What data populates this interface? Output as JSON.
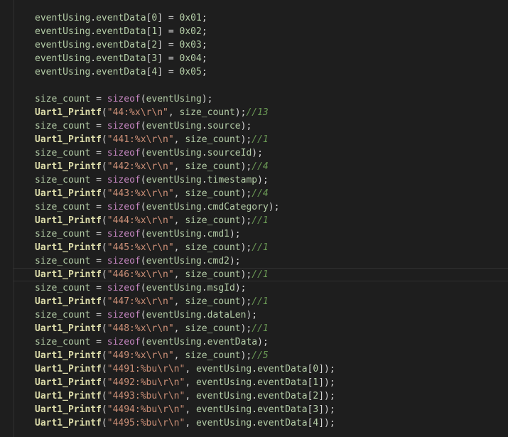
{
  "editor": {
    "colors": {
      "background": "#1e1e1e",
      "variable": "#9cdcfe",
      "identifier": "#b5cea8",
      "function": "#dcdcaa",
      "keyword": "#c586c0",
      "number": "#b5cea8",
      "string": "#ce9178",
      "comment": "#6a9955",
      "punctuation": "#d4d4d4",
      "bracket": "#da70d6"
    },
    "current_line_index": 19,
    "lines": [
      [
        {
          "t": "eventUsing",
          "c": "#b5cea8"
        },
        {
          "t": ".",
          "c": "#d4d4d4"
        },
        {
          "t": "eventData",
          "c": "#b5cea8"
        },
        {
          "t": "[",
          "c": "#d4d4d4"
        },
        {
          "t": "0",
          "c": "#b5cea8"
        },
        {
          "t": "]",
          "c": "#d4d4d4"
        },
        {
          "t": " = ",
          "c": "#d4d4d4"
        },
        {
          "t": "0x01",
          "c": "#b5cea8"
        },
        {
          "t": ";",
          "c": "#d4d4d4"
        }
      ],
      [
        {
          "t": "eventUsing",
          "c": "#b5cea8"
        },
        {
          "t": ".",
          "c": "#d4d4d4"
        },
        {
          "t": "eventData",
          "c": "#b5cea8"
        },
        {
          "t": "[",
          "c": "#d4d4d4"
        },
        {
          "t": "1",
          "c": "#b5cea8"
        },
        {
          "t": "]",
          "c": "#d4d4d4"
        },
        {
          "t": " = ",
          "c": "#d4d4d4"
        },
        {
          "t": "0x02",
          "c": "#b5cea8"
        },
        {
          "t": ";",
          "c": "#d4d4d4"
        }
      ],
      [
        {
          "t": "eventUsing",
          "c": "#b5cea8"
        },
        {
          "t": ".",
          "c": "#d4d4d4"
        },
        {
          "t": "eventData",
          "c": "#b5cea8"
        },
        {
          "t": "[",
          "c": "#d4d4d4"
        },
        {
          "t": "2",
          "c": "#b5cea8"
        },
        {
          "t": "]",
          "c": "#d4d4d4"
        },
        {
          "t": " = ",
          "c": "#d4d4d4"
        },
        {
          "t": "0x03",
          "c": "#b5cea8"
        },
        {
          "t": ";",
          "c": "#d4d4d4"
        }
      ],
      [
        {
          "t": "eventUsing",
          "c": "#b5cea8"
        },
        {
          "t": ".",
          "c": "#d4d4d4"
        },
        {
          "t": "eventData",
          "c": "#b5cea8"
        },
        {
          "t": "[",
          "c": "#d4d4d4"
        },
        {
          "t": "3",
          "c": "#b5cea8"
        },
        {
          "t": "]",
          "c": "#d4d4d4"
        },
        {
          "t": " = ",
          "c": "#d4d4d4"
        },
        {
          "t": "0x04",
          "c": "#b5cea8"
        },
        {
          "t": ";",
          "c": "#d4d4d4"
        }
      ],
      [
        {
          "t": "eventUsing",
          "c": "#b5cea8"
        },
        {
          "t": ".",
          "c": "#d4d4d4"
        },
        {
          "t": "eventData",
          "c": "#b5cea8"
        },
        {
          "t": "[",
          "c": "#d4d4d4"
        },
        {
          "t": "4",
          "c": "#b5cea8"
        },
        {
          "t": "]",
          "c": "#d4d4d4"
        },
        {
          "t": " = ",
          "c": "#d4d4d4"
        },
        {
          "t": "0x05",
          "c": "#b5cea8"
        },
        {
          "t": ";",
          "c": "#d4d4d4"
        }
      ],
      [],
      [
        {
          "t": "size_count",
          "c": "#b5cea8"
        },
        {
          "t": " = ",
          "c": "#d4d4d4"
        },
        {
          "t": "sizeof",
          "c": "#c586c0"
        },
        {
          "t": "(",
          "c": "#d4d4d4"
        },
        {
          "t": "eventUsing",
          "c": "#b5cea8"
        },
        {
          "t": ");",
          "c": "#d4d4d4"
        }
      ],
      [
        {
          "t": "Uart1_Printf",
          "c": "#dcdcaa",
          "b": true
        },
        {
          "t": "(",
          "c": "#d4d4d4"
        },
        {
          "t": "\"44:%x\\r\\n\"",
          "c": "#ce9178"
        },
        {
          "t": ", ",
          "c": "#d4d4d4"
        },
        {
          "t": "size_count",
          "c": "#b5cea8"
        },
        {
          "t": ");",
          "c": "#d4d4d4"
        },
        {
          "t": "//13",
          "c": "#6a9955",
          "i": true
        }
      ],
      [
        {
          "t": "size_count",
          "c": "#b5cea8"
        },
        {
          "t": " = ",
          "c": "#d4d4d4"
        },
        {
          "t": "sizeof",
          "c": "#c586c0"
        },
        {
          "t": "(",
          "c": "#d4d4d4"
        },
        {
          "t": "eventUsing",
          "c": "#b5cea8"
        },
        {
          "t": ".",
          "c": "#d4d4d4"
        },
        {
          "t": "source",
          "c": "#b5cea8"
        },
        {
          "t": ");",
          "c": "#d4d4d4"
        }
      ],
      [
        {
          "t": "Uart1_Printf",
          "c": "#dcdcaa",
          "b": true
        },
        {
          "t": "(",
          "c": "#d4d4d4"
        },
        {
          "t": "\"441:%x\\r\\n\"",
          "c": "#ce9178"
        },
        {
          "t": ", ",
          "c": "#d4d4d4"
        },
        {
          "t": "size_count",
          "c": "#b5cea8"
        },
        {
          "t": ");",
          "c": "#d4d4d4"
        },
        {
          "t": "//1",
          "c": "#6a9955",
          "i": true
        }
      ],
      [
        {
          "t": "size_count",
          "c": "#b5cea8"
        },
        {
          "t": " = ",
          "c": "#d4d4d4"
        },
        {
          "t": "sizeof",
          "c": "#c586c0"
        },
        {
          "t": "(",
          "c": "#d4d4d4"
        },
        {
          "t": "eventUsing",
          "c": "#b5cea8"
        },
        {
          "t": ".",
          "c": "#d4d4d4"
        },
        {
          "t": "sourceId",
          "c": "#b5cea8"
        },
        {
          "t": ");",
          "c": "#d4d4d4"
        }
      ],
      [
        {
          "t": "Uart1_Printf",
          "c": "#dcdcaa",
          "b": true
        },
        {
          "t": "(",
          "c": "#d4d4d4"
        },
        {
          "t": "\"442:%x\\r\\n\"",
          "c": "#ce9178"
        },
        {
          "t": ", ",
          "c": "#d4d4d4"
        },
        {
          "t": "size_count",
          "c": "#b5cea8"
        },
        {
          "t": ");",
          "c": "#d4d4d4"
        },
        {
          "t": "//4",
          "c": "#6a9955",
          "i": true
        }
      ],
      [
        {
          "t": "size_count",
          "c": "#b5cea8"
        },
        {
          "t": " = ",
          "c": "#d4d4d4"
        },
        {
          "t": "sizeof",
          "c": "#c586c0"
        },
        {
          "t": "(",
          "c": "#d4d4d4"
        },
        {
          "t": "eventUsing",
          "c": "#b5cea8"
        },
        {
          "t": ".",
          "c": "#d4d4d4"
        },
        {
          "t": "timestamp",
          "c": "#b5cea8"
        },
        {
          "t": ");",
          "c": "#d4d4d4"
        }
      ],
      [
        {
          "t": "Uart1_Printf",
          "c": "#dcdcaa",
          "b": true
        },
        {
          "t": "(",
          "c": "#d4d4d4"
        },
        {
          "t": "\"443:%x\\r\\n\"",
          "c": "#ce9178"
        },
        {
          "t": ", ",
          "c": "#d4d4d4"
        },
        {
          "t": "size_count",
          "c": "#b5cea8"
        },
        {
          "t": ");",
          "c": "#d4d4d4"
        },
        {
          "t": "//4",
          "c": "#6a9955",
          "i": true
        }
      ],
      [
        {
          "t": "size_count",
          "c": "#b5cea8"
        },
        {
          "t": " = ",
          "c": "#d4d4d4"
        },
        {
          "t": "sizeof",
          "c": "#c586c0"
        },
        {
          "t": "(",
          "c": "#d4d4d4"
        },
        {
          "t": "eventUsing",
          "c": "#b5cea8"
        },
        {
          "t": ".",
          "c": "#d4d4d4"
        },
        {
          "t": "cmdCategory",
          "c": "#b5cea8"
        },
        {
          "t": ");",
          "c": "#d4d4d4"
        }
      ],
      [
        {
          "t": "Uart1_Printf",
          "c": "#dcdcaa",
          "b": true
        },
        {
          "t": "(",
          "c": "#d4d4d4"
        },
        {
          "t": "\"444:%x\\r\\n\"",
          "c": "#ce9178"
        },
        {
          "t": ", ",
          "c": "#d4d4d4"
        },
        {
          "t": "size_count",
          "c": "#b5cea8"
        },
        {
          "t": ");",
          "c": "#d4d4d4"
        },
        {
          "t": "//1",
          "c": "#6a9955",
          "i": true
        }
      ],
      [
        {
          "t": "size_count",
          "c": "#b5cea8"
        },
        {
          "t": " = ",
          "c": "#d4d4d4"
        },
        {
          "t": "sizeof",
          "c": "#c586c0"
        },
        {
          "t": "(",
          "c": "#d4d4d4"
        },
        {
          "t": "eventUsing",
          "c": "#b5cea8"
        },
        {
          "t": ".",
          "c": "#d4d4d4"
        },
        {
          "t": "cmd1",
          "c": "#b5cea8"
        },
        {
          "t": ");",
          "c": "#d4d4d4"
        }
      ],
      [
        {
          "t": "Uart1_Printf",
          "c": "#dcdcaa",
          "b": true
        },
        {
          "t": "(",
          "c": "#d4d4d4"
        },
        {
          "t": "\"445:%x\\r\\n\"",
          "c": "#ce9178"
        },
        {
          "t": ", ",
          "c": "#d4d4d4"
        },
        {
          "t": "size_count",
          "c": "#b5cea8"
        },
        {
          "t": ");",
          "c": "#d4d4d4"
        },
        {
          "t": "//1",
          "c": "#6a9955",
          "i": true
        }
      ],
      [
        {
          "t": "size_count",
          "c": "#b5cea8"
        },
        {
          "t": " = ",
          "c": "#d4d4d4"
        },
        {
          "t": "sizeof",
          "c": "#c586c0"
        },
        {
          "t": "(",
          "c": "#d4d4d4"
        },
        {
          "t": "eventUsing",
          "c": "#b5cea8"
        },
        {
          "t": ".",
          "c": "#d4d4d4"
        },
        {
          "t": "cmd2",
          "c": "#b5cea8"
        },
        {
          "t": ");",
          "c": "#d4d4d4"
        }
      ],
      [
        {
          "t": "Uart1_Printf",
          "c": "#dcdcaa",
          "b": true
        },
        {
          "t": "(",
          "c": "#d4d4d4"
        },
        {
          "t": "\"446:%x\\r\\n\"",
          "c": "#ce9178"
        },
        {
          "t": ", ",
          "c": "#d4d4d4"
        },
        {
          "t": "size_count",
          "c": "#b5cea8"
        },
        {
          "t": ");",
          "c": "#d4d4d4"
        },
        {
          "t": "//1",
          "c": "#6a9955",
          "i": true
        }
      ],
      [
        {
          "t": "size_count",
          "c": "#b5cea8"
        },
        {
          "t": " = ",
          "c": "#d4d4d4"
        },
        {
          "t": "sizeof",
          "c": "#c586c0"
        },
        {
          "t": "(",
          "c": "#d4d4d4"
        },
        {
          "t": "eventUsing",
          "c": "#b5cea8"
        },
        {
          "t": ".",
          "c": "#d4d4d4"
        },
        {
          "t": "msgId",
          "c": "#b5cea8"
        },
        {
          "t": ");",
          "c": "#d4d4d4"
        }
      ],
      [
        {
          "t": "Uart1_Printf",
          "c": "#dcdcaa",
          "b": true
        },
        {
          "t": "(",
          "c": "#d4d4d4"
        },
        {
          "t": "\"447:%x\\r\\n\"",
          "c": "#ce9178"
        },
        {
          "t": ", ",
          "c": "#d4d4d4"
        },
        {
          "t": "size_count",
          "c": "#b5cea8"
        },
        {
          "t": ");",
          "c": "#d4d4d4"
        },
        {
          "t": "//1",
          "c": "#6a9955",
          "i": true
        }
      ],
      [
        {
          "t": "size_count",
          "c": "#b5cea8"
        },
        {
          "t": " = ",
          "c": "#d4d4d4"
        },
        {
          "t": "sizeof",
          "c": "#c586c0"
        },
        {
          "t": "(",
          "c": "#d4d4d4"
        },
        {
          "t": "eventUsing",
          "c": "#b5cea8"
        },
        {
          "t": ".",
          "c": "#d4d4d4"
        },
        {
          "t": "dataLen",
          "c": "#b5cea8"
        },
        {
          "t": ");",
          "c": "#d4d4d4"
        }
      ],
      [
        {
          "t": "Uart1_Printf",
          "c": "#dcdcaa",
          "b": true
        },
        {
          "t": "(",
          "c": "#d4d4d4"
        },
        {
          "t": "\"448:%x\\r\\n\"",
          "c": "#ce9178"
        },
        {
          "t": ", ",
          "c": "#d4d4d4"
        },
        {
          "t": "size_count",
          "c": "#b5cea8"
        },
        {
          "t": ");",
          "c": "#d4d4d4"
        },
        {
          "t": "//1",
          "c": "#6a9955",
          "i": true
        }
      ],
      [
        {
          "t": "size_count",
          "c": "#b5cea8"
        },
        {
          "t": " = ",
          "c": "#d4d4d4"
        },
        {
          "t": "sizeof",
          "c": "#c586c0"
        },
        {
          "t": "(",
          "c": "#d4d4d4"
        },
        {
          "t": "eventUsing",
          "c": "#b5cea8"
        },
        {
          "t": ".",
          "c": "#d4d4d4"
        },
        {
          "t": "eventData",
          "c": "#b5cea8"
        },
        {
          "t": ");",
          "c": "#d4d4d4"
        }
      ],
      [
        {
          "t": "Uart1_Printf",
          "c": "#dcdcaa",
          "b": true
        },
        {
          "t": "(",
          "c": "#d4d4d4"
        },
        {
          "t": "\"449:%x\\r\\n\"",
          "c": "#ce9178"
        },
        {
          "t": ", ",
          "c": "#d4d4d4"
        },
        {
          "t": "size_count",
          "c": "#b5cea8"
        },
        {
          "t": ");",
          "c": "#d4d4d4"
        },
        {
          "t": "//5",
          "c": "#6a9955",
          "i": true
        }
      ],
      [
        {
          "t": "Uart1_Printf",
          "c": "#dcdcaa",
          "b": true
        },
        {
          "t": "(",
          "c": "#d4d4d4"
        },
        {
          "t": "\"4491:%bu\\r\\n\"",
          "c": "#ce9178"
        },
        {
          "t": ", ",
          "c": "#d4d4d4"
        },
        {
          "t": "eventUsing",
          "c": "#b5cea8"
        },
        {
          "t": ".",
          "c": "#d4d4d4"
        },
        {
          "t": "eventData",
          "c": "#b5cea8"
        },
        {
          "t": "[",
          "c": "#d4d4d4"
        },
        {
          "t": "0",
          "c": "#b5cea8"
        },
        {
          "t": "]",
          "c": "#d4d4d4"
        },
        {
          "t": ");",
          "c": "#d4d4d4"
        }
      ],
      [
        {
          "t": "Uart1_Printf",
          "c": "#dcdcaa",
          "b": true
        },
        {
          "t": "(",
          "c": "#d4d4d4"
        },
        {
          "t": "\"4492:%bu\\r\\n\"",
          "c": "#ce9178"
        },
        {
          "t": ", ",
          "c": "#d4d4d4"
        },
        {
          "t": "eventUsing",
          "c": "#b5cea8"
        },
        {
          "t": ".",
          "c": "#d4d4d4"
        },
        {
          "t": "eventData",
          "c": "#b5cea8"
        },
        {
          "t": "[",
          "c": "#d4d4d4"
        },
        {
          "t": "1",
          "c": "#b5cea8"
        },
        {
          "t": "]",
          "c": "#d4d4d4"
        },
        {
          "t": ");",
          "c": "#d4d4d4"
        }
      ],
      [
        {
          "t": "Uart1_Printf",
          "c": "#dcdcaa",
          "b": true
        },
        {
          "t": "(",
          "c": "#d4d4d4"
        },
        {
          "t": "\"4493:%bu\\r\\n\"",
          "c": "#ce9178"
        },
        {
          "t": ", ",
          "c": "#d4d4d4"
        },
        {
          "t": "eventUsing",
          "c": "#b5cea8"
        },
        {
          "t": ".",
          "c": "#d4d4d4"
        },
        {
          "t": "eventData",
          "c": "#b5cea8"
        },
        {
          "t": "[",
          "c": "#d4d4d4"
        },
        {
          "t": "2",
          "c": "#b5cea8"
        },
        {
          "t": "]",
          "c": "#d4d4d4"
        },
        {
          "t": ");",
          "c": "#d4d4d4"
        }
      ],
      [
        {
          "t": "Uart1_Printf",
          "c": "#dcdcaa",
          "b": true
        },
        {
          "t": "(",
          "c": "#d4d4d4"
        },
        {
          "t": "\"4494:%bu\\r\\n\"",
          "c": "#ce9178"
        },
        {
          "t": ", ",
          "c": "#d4d4d4"
        },
        {
          "t": "eventUsing",
          "c": "#b5cea8"
        },
        {
          "t": ".",
          "c": "#d4d4d4"
        },
        {
          "t": "eventData",
          "c": "#b5cea8"
        },
        {
          "t": "[",
          "c": "#d4d4d4"
        },
        {
          "t": "3",
          "c": "#b5cea8"
        },
        {
          "t": "]",
          "c": "#d4d4d4"
        },
        {
          "t": ");",
          "c": "#d4d4d4"
        }
      ],
      [
        {
          "t": "Uart1_Printf",
          "c": "#dcdcaa",
          "b": true
        },
        {
          "t": "(",
          "c": "#d4d4d4"
        },
        {
          "t": "\"4495:%bu\\r\\n\"",
          "c": "#ce9178"
        },
        {
          "t": ", ",
          "c": "#d4d4d4"
        },
        {
          "t": "eventUsing",
          "c": "#b5cea8"
        },
        {
          "t": ".",
          "c": "#d4d4d4"
        },
        {
          "t": "eventData",
          "c": "#b5cea8"
        },
        {
          "t": "[",
          "c": "#d4d4d4"
        },
        {
          "t": "4",
          "c": "#b5cea8"
        },
        {
          "t": "]",
          "c": "#d4d4d4"
        },
        {
          "t": ");",
          "c": "#d4d4d4"
        }
      ]
    ]
  }
}
